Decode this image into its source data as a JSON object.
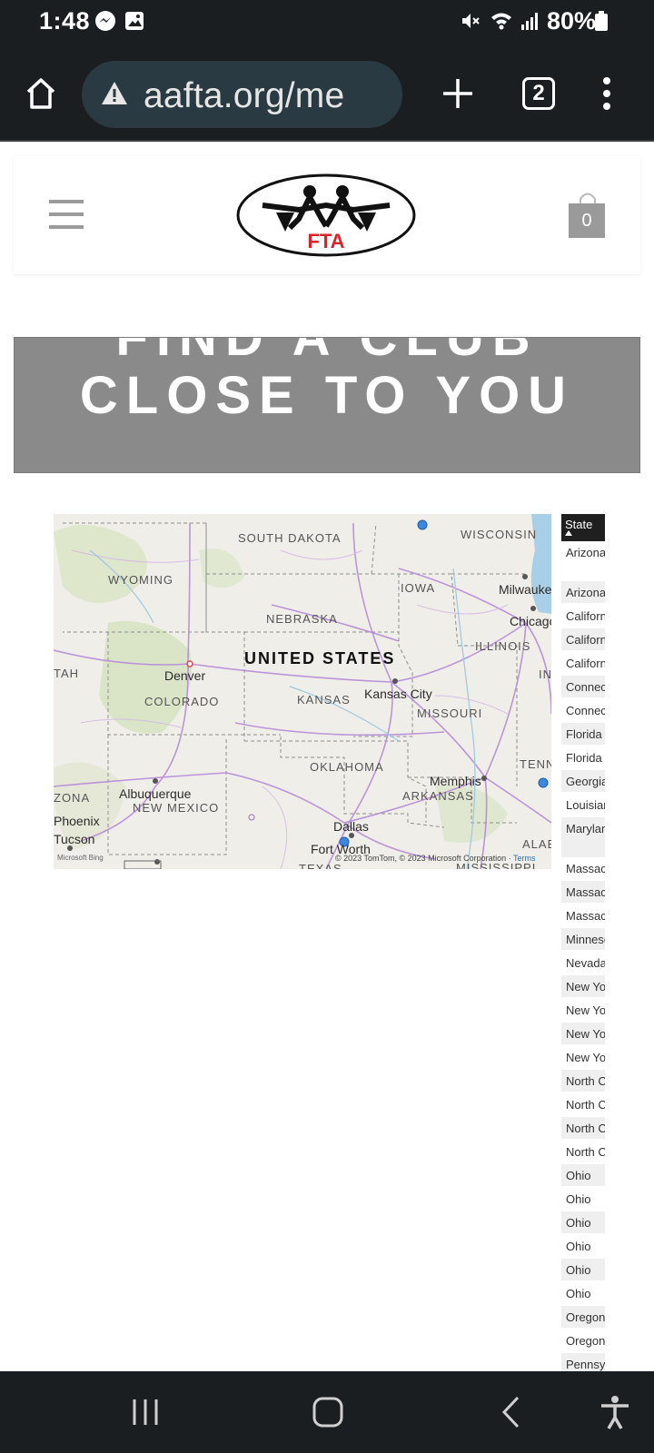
{
  "status_bar": {
    "time": "1:48",
    "battery": "80%",
    "icons": [
      "messenger-icon",
      "gallery-icon",
      "mute-icon",
      "wifi-icon",
      "signal-icon",
      "battery-icon"
    ]
  },
  "browser": {
    "url": "aafta.org/me",
    "tab_count": "2",
    "icons": [
      "home-icon",
      "warning-icon",
      "new-tab-icon",
      "tabs-icon",
      "more-icon"
    ]
  },
  "header": {
    "logo_text": "FTA",
    "cart_count": "0"
  },
  "banner": {
    "line1": "FIND A CLUB",
    "line2": "CLOSE TO YOU"
  },
  "map": {
    "country": "UNITED STATES",
    "states": [
      {
        "name": "SOUTH DAKOTA"
      },
      {
        "name": "WISCONSIN"
      },
      {
        "name": "WYOMING"
      },
      {
        "name": "IOWA"
      },
      {
        "name": "NEBRASKA"
      },
      {
        "name": "ILLINOIS"
      },
      {
        "name": "COLORADO"
      },
      {
        "name": "KANSAS"
      },
      {
        "name": "MISSOURI"
      },
      {
        "name": "OKLAHOMA"
      },
      {
        "name": "TENN"
      },
      {
        "name": "ARKANSAS"
      },
      {
        "name": "NEW MEXICO"
      },
      {
        "name": "ZONA"
      },
      {
        "name": "TAH"
      },
      {
        "name": "ALAB"
      },
      {
        "name": "TEXAS"
      },
      {
        "name": "MISSISSIPPI"
      },
      {
        "name": "IN"
      }
    ],
    "cities": [
      {
        "name": "Milwaukee"
      },
      {
        "name": "Chicago"
      },
      {
        "name": "Denver"
      },
      {
        "name": "Kansas City"
      },
      {
        "name": "Memphis"
      },
      {
        "name": "Albuquerque"
      },
      {
        "name": "Phoenix"
      },
      {
        "name": "Tucson"
      },
      {
        "name": "Dallas"
      },
      {
        "name": "Fort Worth"
      }
    ],
    "copyright": "© 2023 TomTom, © 2023 Microsoft Corporation",
    "terms": "Terms",
    "attribution": "Microsoft Bing"
  },
  "table": {
    "header": "State",
    "rows": [
      "Arizona",
      "Arizona",
      "California",
      "California",
      "California",
      "Connecticut",
      "Connecticut",
      "Florida",
      "Florida",
      "Georgia",
      "Louisiana",
      "Maryland",
      "Massachusetts",
      "Massachusetts",
      "Massachusetts",
      "Minnesota",
      "Nevada",
      "New York",
      "New York",
      "New York",
      "New York",
      "North Carolina",
      "North Carolina",
      "North Carolina",
      "North Carolina",
      "Ohio",
      "Ohio",
      "Ohio",
      "Ohio",
      "Ohio",
      "Ohio",
      "Oregon",
      "Oregon",
      "Pennsylvania"
    ]
  },
  "nav": {
    "icons": [
      "recent-apps-icon",
      "home-nav-icon",
      "back-icon",
      "accessibility-icon"
    ]
  }
}
